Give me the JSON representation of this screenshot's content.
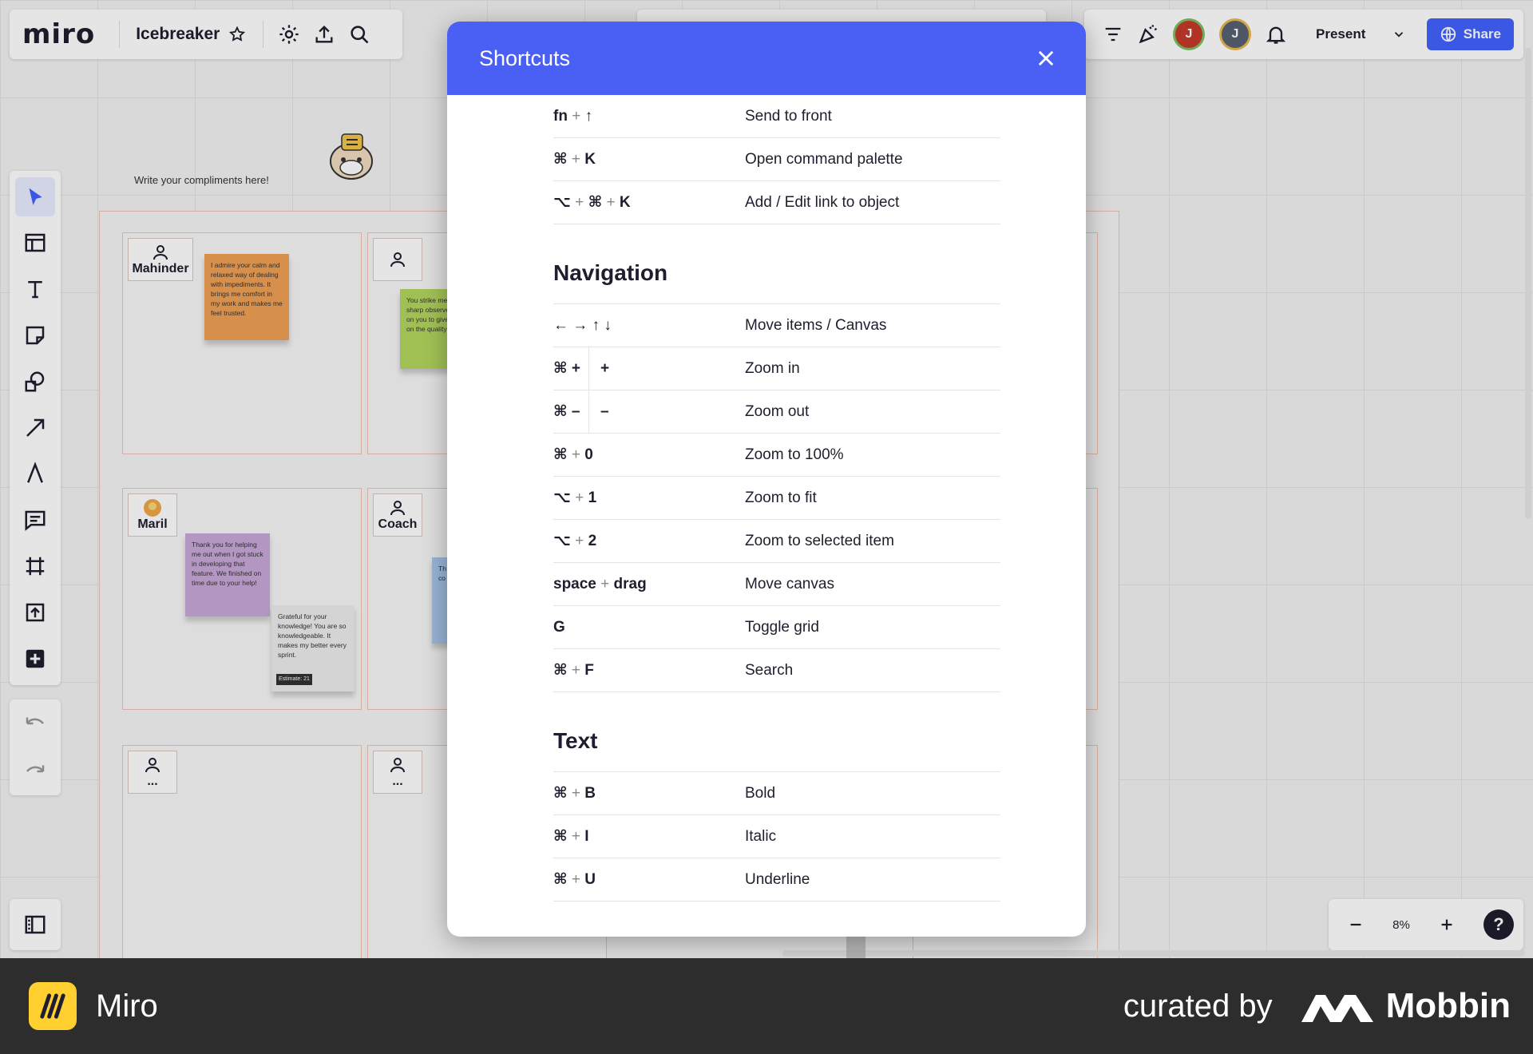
{
  "app": {
    "logo": "miro",
    "board_name": "Icebreaker"
  },
  "top_right": {
    "avatars": [
      {
        "initial": "J",
        "color": "#c6392b"
      },
      {
        "initial": "J",
        "color": "#566173"
      }
    ],
    "present_label": "Present",
    "share_label": "Share"
  },
  "board": {
    "compliment_hint": "Write your compliments here!",
    "cells": [
      {
        "name": "Mahinder"
      },
      {
        "name": ""
      },
      {
        "name": "Maril"
      },
      {
        "name": "Coach"
      },
      {
        "name": "..."
      },
      {
        "name": "..."
      }
    ],
    "stickies": [
      {
        "text": "I admire your calm and relaxed way of dealing with impediments. It brings me comfort in my work and makes me feel trusted.",
        "color": "#f0a155"
      },
      {
        "text": "You strike me as sharp observer. I rely on you to give input on the quality of work.",
        "color": "#b4d65e"
      },
      {
        "text": "Thank you for helping me out when I got stuck in developing that feature. We finished on time due to your help!",
        "color": "#c9a7d9"
      },
      {
        "text": "Grateful for your knowledge! You are so knowledgeable. It makes my better every sprint.",
        "color": "#ececec"
      },
      {
        "text": "Th ge yo co m de dis",
        "color": "#a8c8ee"
      }
    ],
    "sticky_badge": "Estimate: 21"
  },
  "zoom": {
    "level": "8%",
    "help": "?"
  },
  "modal": {
    "title": "Shortcuts",
    "top_rows": [
      {
        "keys": [
          "fn",
          "↑"
        ],
        "desc": "Send to front"
      },
      {
        "keys": [
          "⌘",
          "K"
        ],
        "desc": "Open command palette"
      },
      {
        "keys": [
          "⌥",
          "⌘",
          "K"
        ],
        "desc": "Add / Edit link to object"
      }
    ],
    "navigation_title": "Navigation",
    "navigation_rows": [
      {
        "keys_text": "← → ↑ ↓",
        "desc": "Move items / Canvas"
      },
      {
        "split_1": "⌘ +",
        "split_2": "+",
        "desc": "Zoom in"
      },
      {
        "split_1": "⌘ –",
        "split_2": "–",
        "desc": "Zoom out"
      },
      {
        "keys": [
          "⌘",
          "0"
        ],
        "desc": "Zoom to 100%"
      },
      {
        "keys": [
          "⌥",
          "1"
        ],
        "desc": "Zoom to fit"
      },
      {
        "keys": [
          "⌥",
          "2"
        ],
        "desc": "Zoom to selected item"
      },
      {
        "keys": [
          "space",
          "drag"
        ],
        "desc": "Move canvas"
      },
      {
        "keys_text": "G",
        "desc": "Toggle grid"
      },
      {
        "keys": [
          "⌘",
          "F"
        ],
        "desc": "Search"
      }
    ],
    "text_title": "Text",
    "text_rows": [
      {
        "keys": [
          "⌘",
          "B"
        ],
        "desc": "Bold"
      },
      {
        "keys": [
          "⌘",
          "I"
        ],
        "desc": "Italic"
      },
      {
        "keys": [
          "⌘",
          "U"
        ],
        "desc": "Underline"
      }
    ]
  },
  "footer": {
    "brand": "Miro",
    "curated_by": "curated by",
    "mobbin": "Mobbin"
  }
}
